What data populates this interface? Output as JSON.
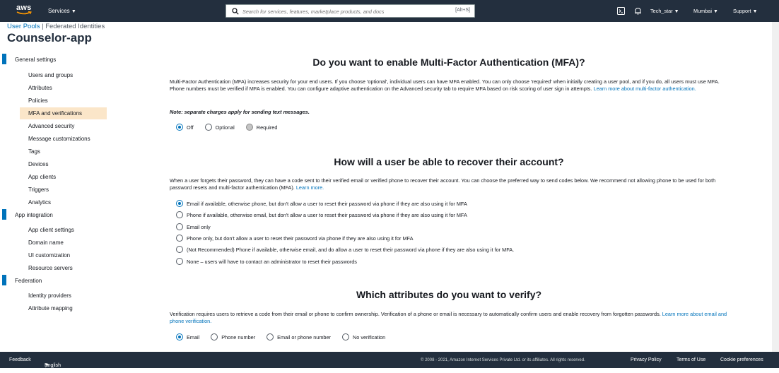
{
  "topnav": {
    "logo_text": "aws",
    "services_label": "Services",
    "search_placeholder": "Search for services, features, marketplace products, and docs",
    "search_shortcut": "[Alt+S]",
    "user": "Tech_star",
    "region": "Mumbai",
    "support": "Support"
  },
  "breadcrumb": {
    "user_pools": "User Pools",
    "separator": "|",
    "federated": "Federated Identities"
  },
  "page_title": "Counselor-app",
  "sidebar": {
    "general_settings": "General settings",
    "general_items": [
      "Users and groups",
      "Attributes",
      "Policies",
      "MFA and verifications",
      "Advanced security",
      "Message customizations",
      "Tags",
      "Devices",
      "App clients",
      "Triggers",
      "Analytics"
    ],
    "app_integration": "App integration",
    "app_items": [
      "App client settings",
      "Domain name",
      "UI customization",
      "Resource servers"
    ],
    "federation": "Federation",
    "federation_items": [
      "Identity providers",
      "Attribute mapping"
    ]
  },
  "mfa": {
    "title": "Do you want to enable Multi-Factor Authentication (MFA)?",
    "description": "Multi-Factor Authentication (MFA) increases security for your end users. If you choose 'optional', individual users can have MFA enabled. You can only choose 'required' when initially creating a user pool, and if you do, all users must use MFA. Phone numbers must be verified if MFA is enabled. You can configure adaptive authentication on the Advanced security tab to require MFA based on risk scoring of user sign in attempts.",
    "learn_more": "Learn more about multi-factor authentication.",
    "note": "Note: separate charges apply for sending text messages.",
    "options": [
      "Off",
      "Optional",
      "Required"
    ],
    "selected": "Off"
  },
  "recovery": {
    "title": "How will a user be able to recover their account?",
    "description": "When a user forgets their password, they can have a code sent to their verified email or verified phone to recover their account. You can choose the preferred way to send codes below. We recommend not allowing phone to be used for both password resets and multi-factor authentication (MFA).",
    "learn_more": "Learn more.",
    "options": [
      "Email if available, otherwise phone, but don't allow a user to reset their password via phone if they are also using it for MFA",
      "Phone if available, otherwise email, but don't allow a user to reset their password via phone if they are also using it for MFA",
      "Email only",
      "Phone only, but don't allow a user to reset their password via phone if they are also using it for MFA",
      "(Not Recommended) Phone if available, otherwise email, and do allow a user to reset their password via phone if they are also using it for MFA.",
      "None – users will have to contact an administrator to reset their passwords"
    ],
    "selected_index": 0
  },
  "verify": {
    "title": "Which attributes do you want to verify?",
    "description": "Verification requires users to retrieve a code from their email or phone to confirm ownership. Verification of a phone or email is necessary to automatically confirm users and enable recovery from forgotten passwords.",
    "learn_more": "Learn more about email and phone verification.",
    "options": [
      "Email",
      "Phone number",
      "Email or phone number",
      "No verification"
    ],
    "selected": "Email"
  },
  "footer": {
    "feedback": "Feedback",
    "language": "English (US)",
    "copyright": "© 2008 - 2021, Amazon Internet Services Private Ltd. or its affiliates. All rights reserved.",
    "privacy": "Privacy Policy",
    "terms": "Terms of Use",
    "cookies": "Cookie preferences"
  },
  "colors": {
    "nav_bg": "#232f3e",
    "link": "#0073bb",
    "active_bg": "#fbe6c9",
    "section_bar": "#0073bb"
  }
}
